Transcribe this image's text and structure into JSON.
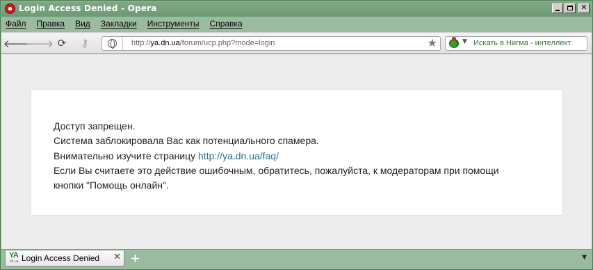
{
  "window": {
    "title": "Login Access Denied - Opera",
    "icon": "opera-logo-icon"
  },
  "menu": {
    "items": [
      "Файл",
      "Правка",
      "Вид",
      "Закладки",
      "Инструменты",
      "Справка"
    ]
  },
  "toolbar": {
    "back_icon": "back-arrow-icon",
    "forward_icon": "forward-arrow-icon",
    "reload_icon": "reload-icon",
    "key_icon": "key-icon",
    "address": {
      "url_prefix": "http://",
      "url_host": "ya.dn.ua",
      "url_path": "/forum/ucp.php?mode=login"
    },
    "search": {
      "placeholder": "Искать в Нигма - интеллект"
    }
  },
  "page": {
    "line1": "Доступ запрещен.",
    "line2": "Система заблокировала Вас как потенциального спамера.",
    "line3_text": "Внимательно изучите страницу ",
    "line3_link": "http://ya.dn.ua/faq/",
    "line4": "Если Вы считаете это действие ошибочным, обратитесь, пожалуйста, к модераторам при помощи",
    "line5": "кнопки \"Помощь онлайн\"."
  },
  "tabs": {
    "active_tab": {
      "title": "Login Access Denied",
      "favicon_text": "YA",
      "favicon_subtext": "dn.ua"
    }
  },
  "colors": {
    "chrome": "#9bbba0",
    "link": "#2a6f8c",
    "content_bg": "#ededed"
  }
}
